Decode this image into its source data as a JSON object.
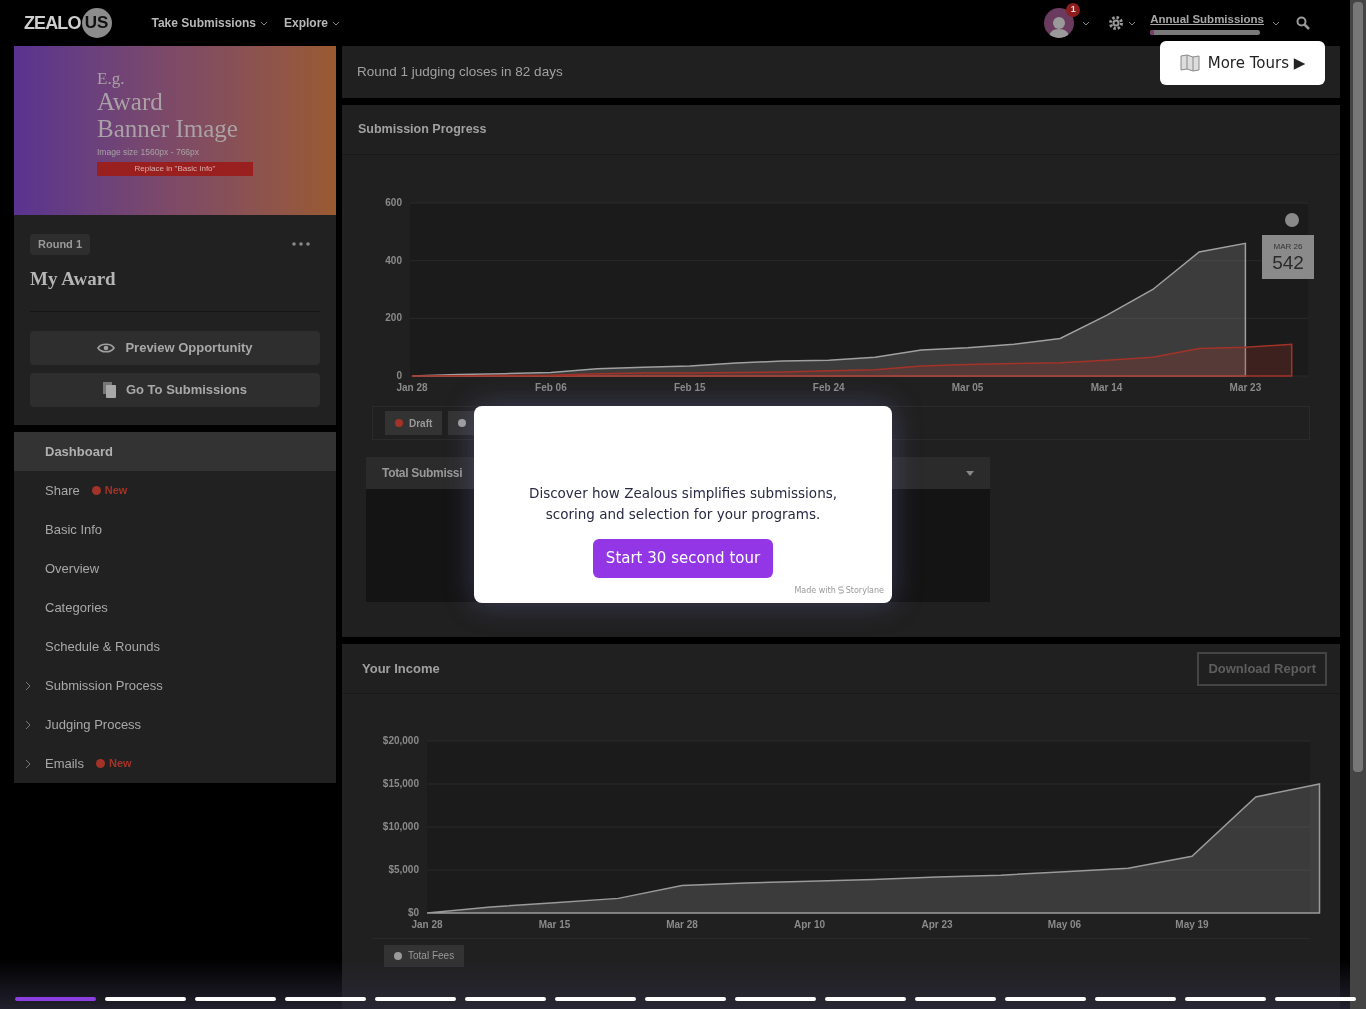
{
  "header": {
    "logo": {
      "part_1": "ZEALO",
      "part_2": "US"
    },
    "nav": [
      {
        "label": "Take Submissions"
      },
      {
        "label": "Explore"
      }
    ],
    "notifications_badge": "1",
    "program": {
      "label": "Annual Submissions",
      "level": 0.03
    }
  },
  "more_tours": {
    "label": "More Tours ▶"
  },
  "sidebar": {
    "banner": {
      "line_1": "E.g.",
      "line_2": "Award",
      "line_3": "Banner Image",
      "size_note": "Image size 1560px - 766px",
      "replace_note": "Replace in \"Basic Info\""
    },
    "round_badge": "Round 1",
    "title": "My Award",
    "buttons": [
      {
        "kind": "preview",
        "label": "Preview Opportunity"
      },
      {
        "kind": "submissions",
        "label": "Go To Submissions"
      }
    ],
    "items": [
      {
        "label": "Dashboard",
        "selected": true,
        "expandable": false
      },
      {
        "label": "Share",
        "selected": false,
        "expandable": false,
        "badge": "New",
        "color": "#a33328"
      },
      {
        "label": "Basic Info",
        "selected": false,
        "expandable": false
      },
      {
        "label": "Overview",
        "selected": false,
        "expandable": false
      },
      {
        "label": "Categories",
        "selected": false,
        "expandable": false
      },
      {
        "label": "Schedule & Rounds",
        "selected": false,
        "expandable": false
      },
      {
        "label": "Submission Process",
        "selected": false,
        "expandable": true
      },
      {
        "label": "Judging Process",
        "selected": false,
        "expandable": true
      },
      {
        "label": "Emails",
        "selected": false,
        "expandable": true,
        "badge": "New",
        "color": "#a33328"
      }
    ]
  },
  "notice": "Round 1 judging closes in 82 days",
  "progress": {
    "title": "Submission Progress",
    "chart_data": {
      "type": "area",
      "categories": [
        "Jan 28",
        null,
        null,
        "Feb 06",
        null,
        null,
        "Feb 15",
        null,
        null,
        "Feb 24",
        null,
        null,
        "Mar 05",
        null,
        null,
        "Mar 14",
        null,
        null,
        "Mar 23",
        null
      ],
      "series": [
        {
          "name": "Draft",
          "color": "#a33328",
          "values": [
            0,
            1,
            2,
            3,
            8,
            10,
            10,
            12,
            14,
            18,
            22,
            35,
            40,
            43,
            46,
            55,
            65,
            95,
            100,
            110
          ]
        },
        {
          "color": "#a0a0a0",
          "values": [
            0,
            5,
            8,
            12,
            25,
            30,
            35,
            45,
            52,
            55,
            65,
            90,
            98,
            110,
            130,
            210,
            300,
            430,
            460,
            null
          ]
        }
      ],
      "ylim": [
        0,
        600
      ],
      "yticks": [
        0,
        200,
        400,
        600
      ],
      "grid": true
    },
    "tooltip": {
      "date": "MAR 26",
      "value": "542"
    },
    "total_card": {
      "title": "Total Submissi"
    }
  },
  "income": {
    "title": "Your Income",
    "download": "Download Report",
    "chart_data": {
      "type": "area",
      "categories": [
        "Jan 28",
        null,
        "Mar 15",
        null,
        "Mar 28",
        null,
        "Apr 10",
        null,
        "Apr 23",
        null,
        "May 06",
        null,
        "May 19",
        null,
        null
      ],
      "series": [
        {
          "name": "Total Fees",
          "color": "#9a9a9a",
          "values": [
            0,
            700,
            1200,
            1700,
            3200,
            3500,
            3700,
            3900,
            4200,
            4400,
            4800,
            5200,
            6600,
            13500,
            15000
          ]
        }
      ],
      "ylim": [
        0,
        20000
      ],
      "yticks": [
        {
          "value": 0,
          "label": "$0"
        },
        {
          "value": 5000,
          "label": "$5,000"
        },
        {
          "value": 10000,
          "label": "$10,000"
        },
        {
          "value": 15000,
          "label": "$15,000"
        },
        {
          "value": 20000,
          "label": "$20,000"
        }
      ],
      "grid": true
    }
  },
  "modal": {
    "text": "Discover how Zealous simplifies submissions, scoring and selection for your programs.",
    "button": "Start 30 second tour",
    "credit_prefix": "Made with",
    "credit_brand": "Storylane"
  },
  "tour_steps": [
    {
      "selected": true
    },
    {
      "selected": false
    },
    {
      "selected": false
    },
    {
      "selected": false
    },
    {
      "selected": false
    },
    {
      "selected": false
    },
    {
      "selected": false
    },
    {
      "selected": false
    },
    {
      "selected": false
    },
    {
      "selected": false
    },
    {
      "selected": false
    },
    {
      "selected": false
    },
    {
      "selected": false
    },
    {
      "selected": false
    },
    {
      "selected": false
    }
  ]
}
